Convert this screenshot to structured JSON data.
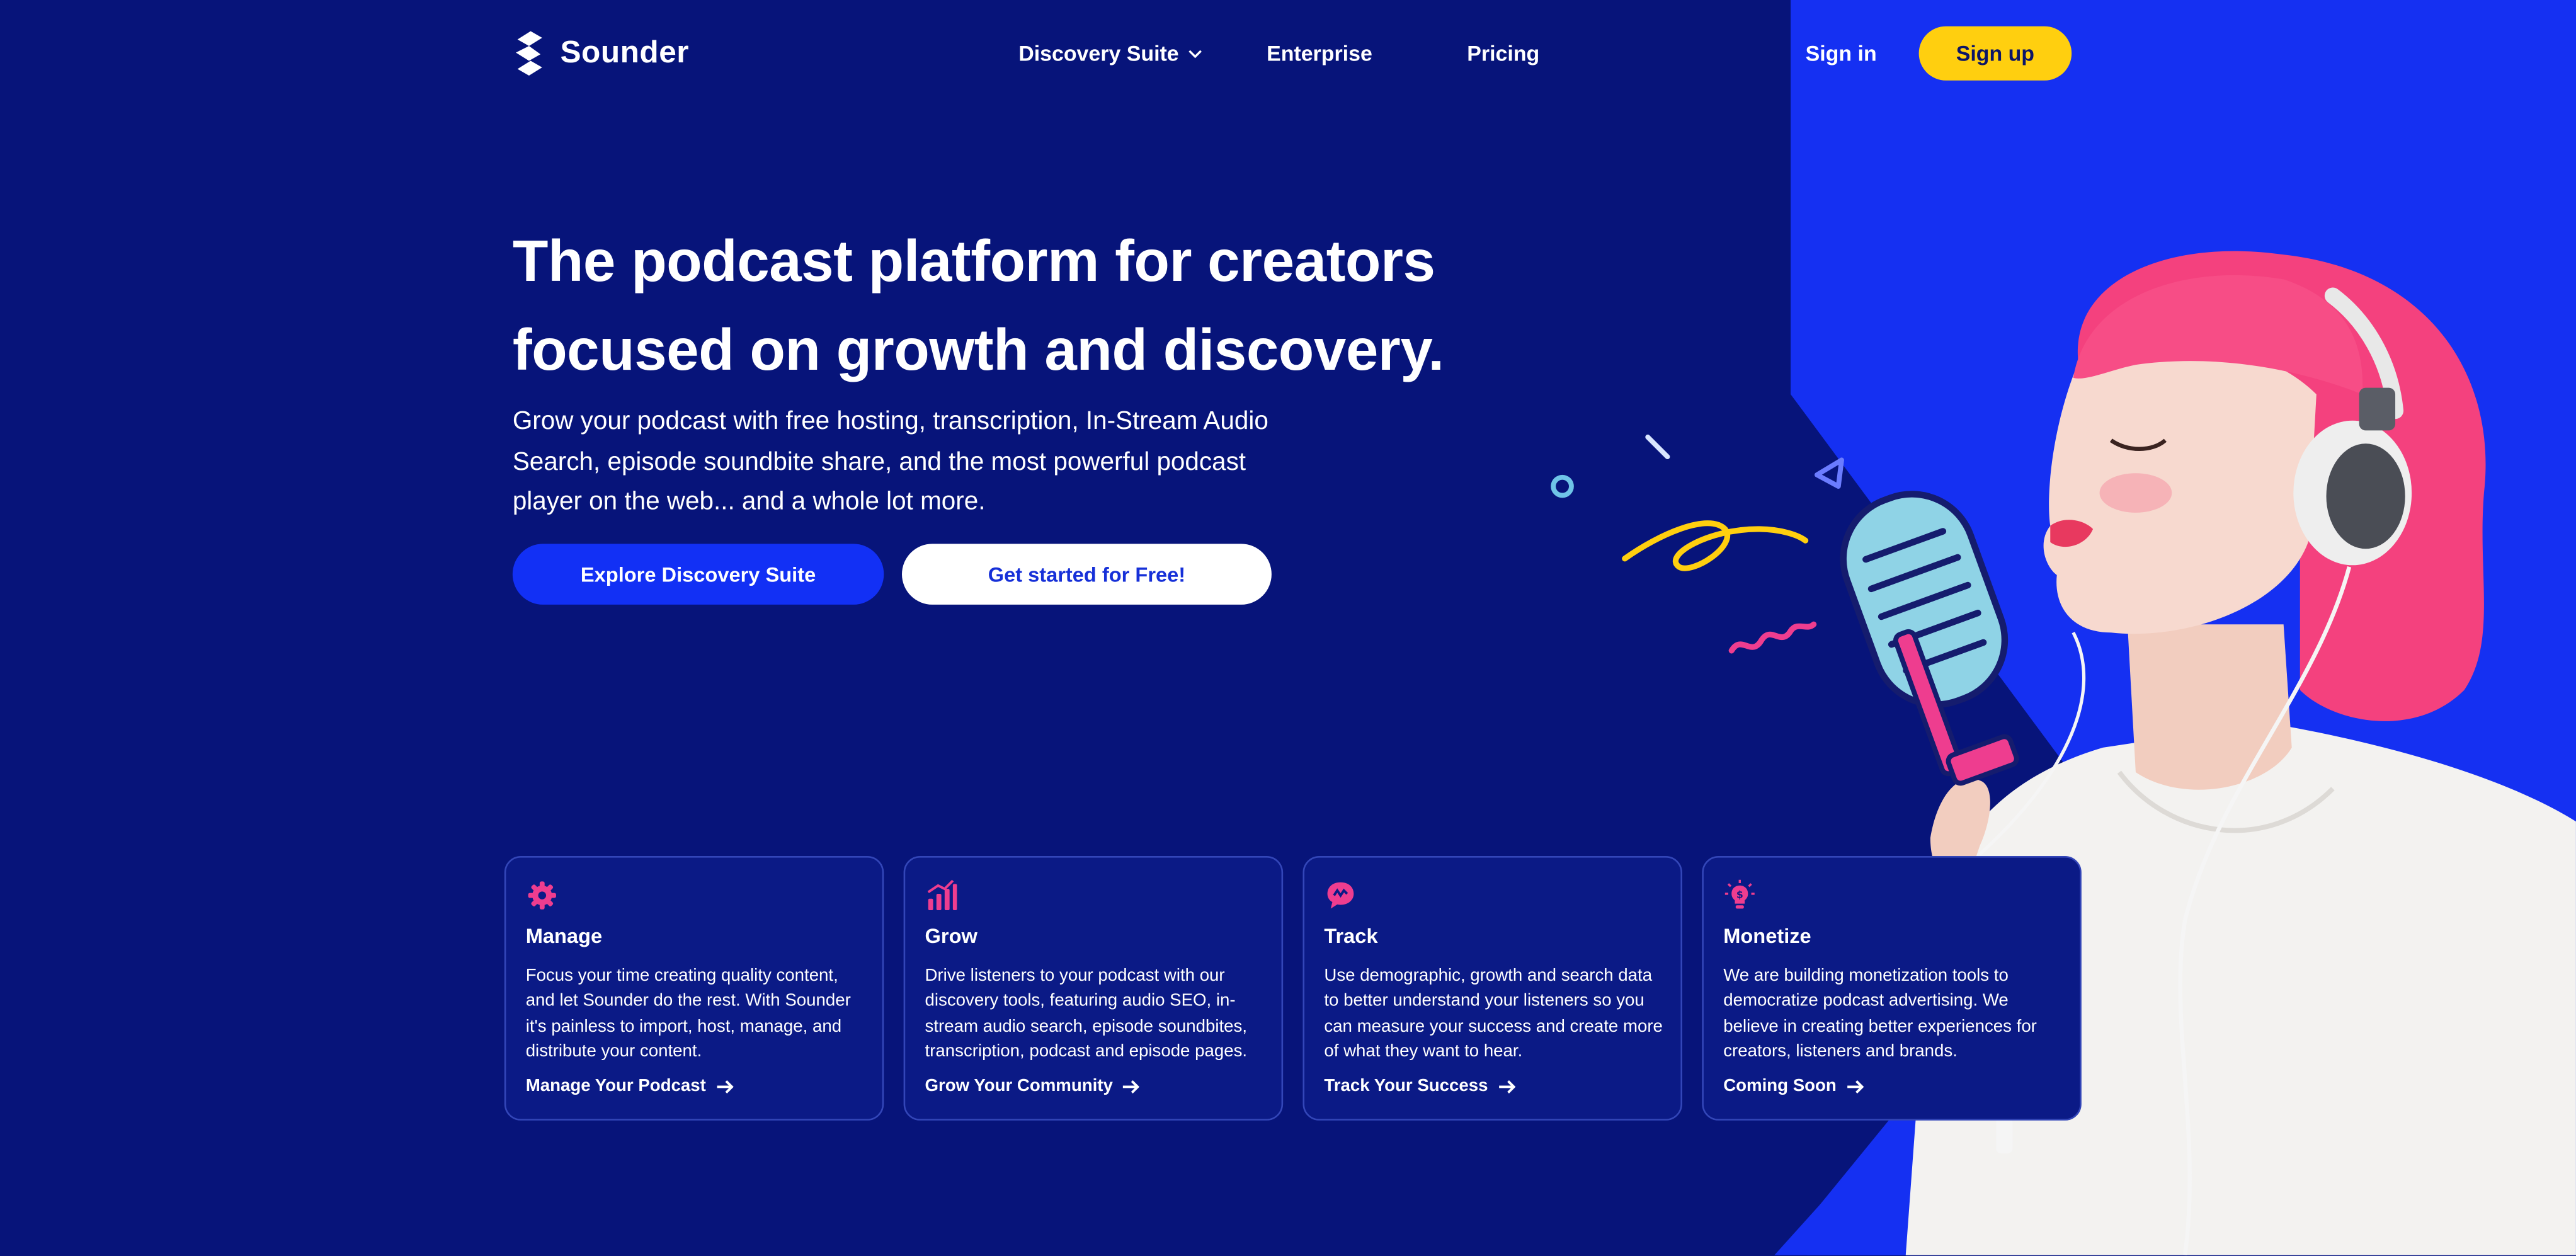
{
  "header": {
    "brand": "Sounder",
    "nav": [
      {
        "label": "Discovery Suite"
      },
      {
        "label": "Enterprise"
      },
      {
        "label": "Pricing"
      }
    ],
    "sign_in": "Sign in",
    "sign_up": "Sign up"
  },
  "hero": {
    "title_line1": "The podcast platform for creators",
    "title_line2": "focused on growth and discovery.",
    "subtitle": "Grow your podcast with free hosting, transcription, In-Stream Audio Search, episode soundbite share, and the most powerful podcast player on the web... and a whole lot more.",
    "primary_cta": "Explore Discovery Suite",
    "secondary_cta": "Get started for Free!"
  },
  "cards": [
    {
      "icon": "gear-icon",
      "title": "Manage",
      "description": "Focus your time creating quality content, and let Sounder do the rest. With Sounder it's painless to import, host, manage, and distribute your content.",
      "link": "Manage Your Podcast"
    },
    {
      "icon": "bar-chart-icon",
      "title": "Grow",
      "description": "Drive listeners to your podcast with our discovery tools, featuring audio SEO, in-stream audio search, episode soundbites, transcription, podcast and episode pages.",
      "link": "Grow Your Community"
    },
    {
      "icon": "chat-bubble-icon",
      "title": "Track",
      "description": "Use demographic, growth and search data to better understand your listeners so you can measure your success and create more of what they want to hear.",
      "link": "Track Your Success"
    },
    {
      "icon": "lightbulb-icon",
      "title": "Monetize",
      "description": "We are building monetization tools to democratize podcast advertising. We believe in creating better experiences for creators, listeners and brands.",
      "link": "Coming Soon"
    }
  ],
  "colors": {
    "background": "#07147a",
    "accent_blue": "#1230f5",
    "signup_yellow": "#ffcf0f",
    "icon_pink": "#ee3d8f",
    "hair_pink": "#f4417e"
  }
}
